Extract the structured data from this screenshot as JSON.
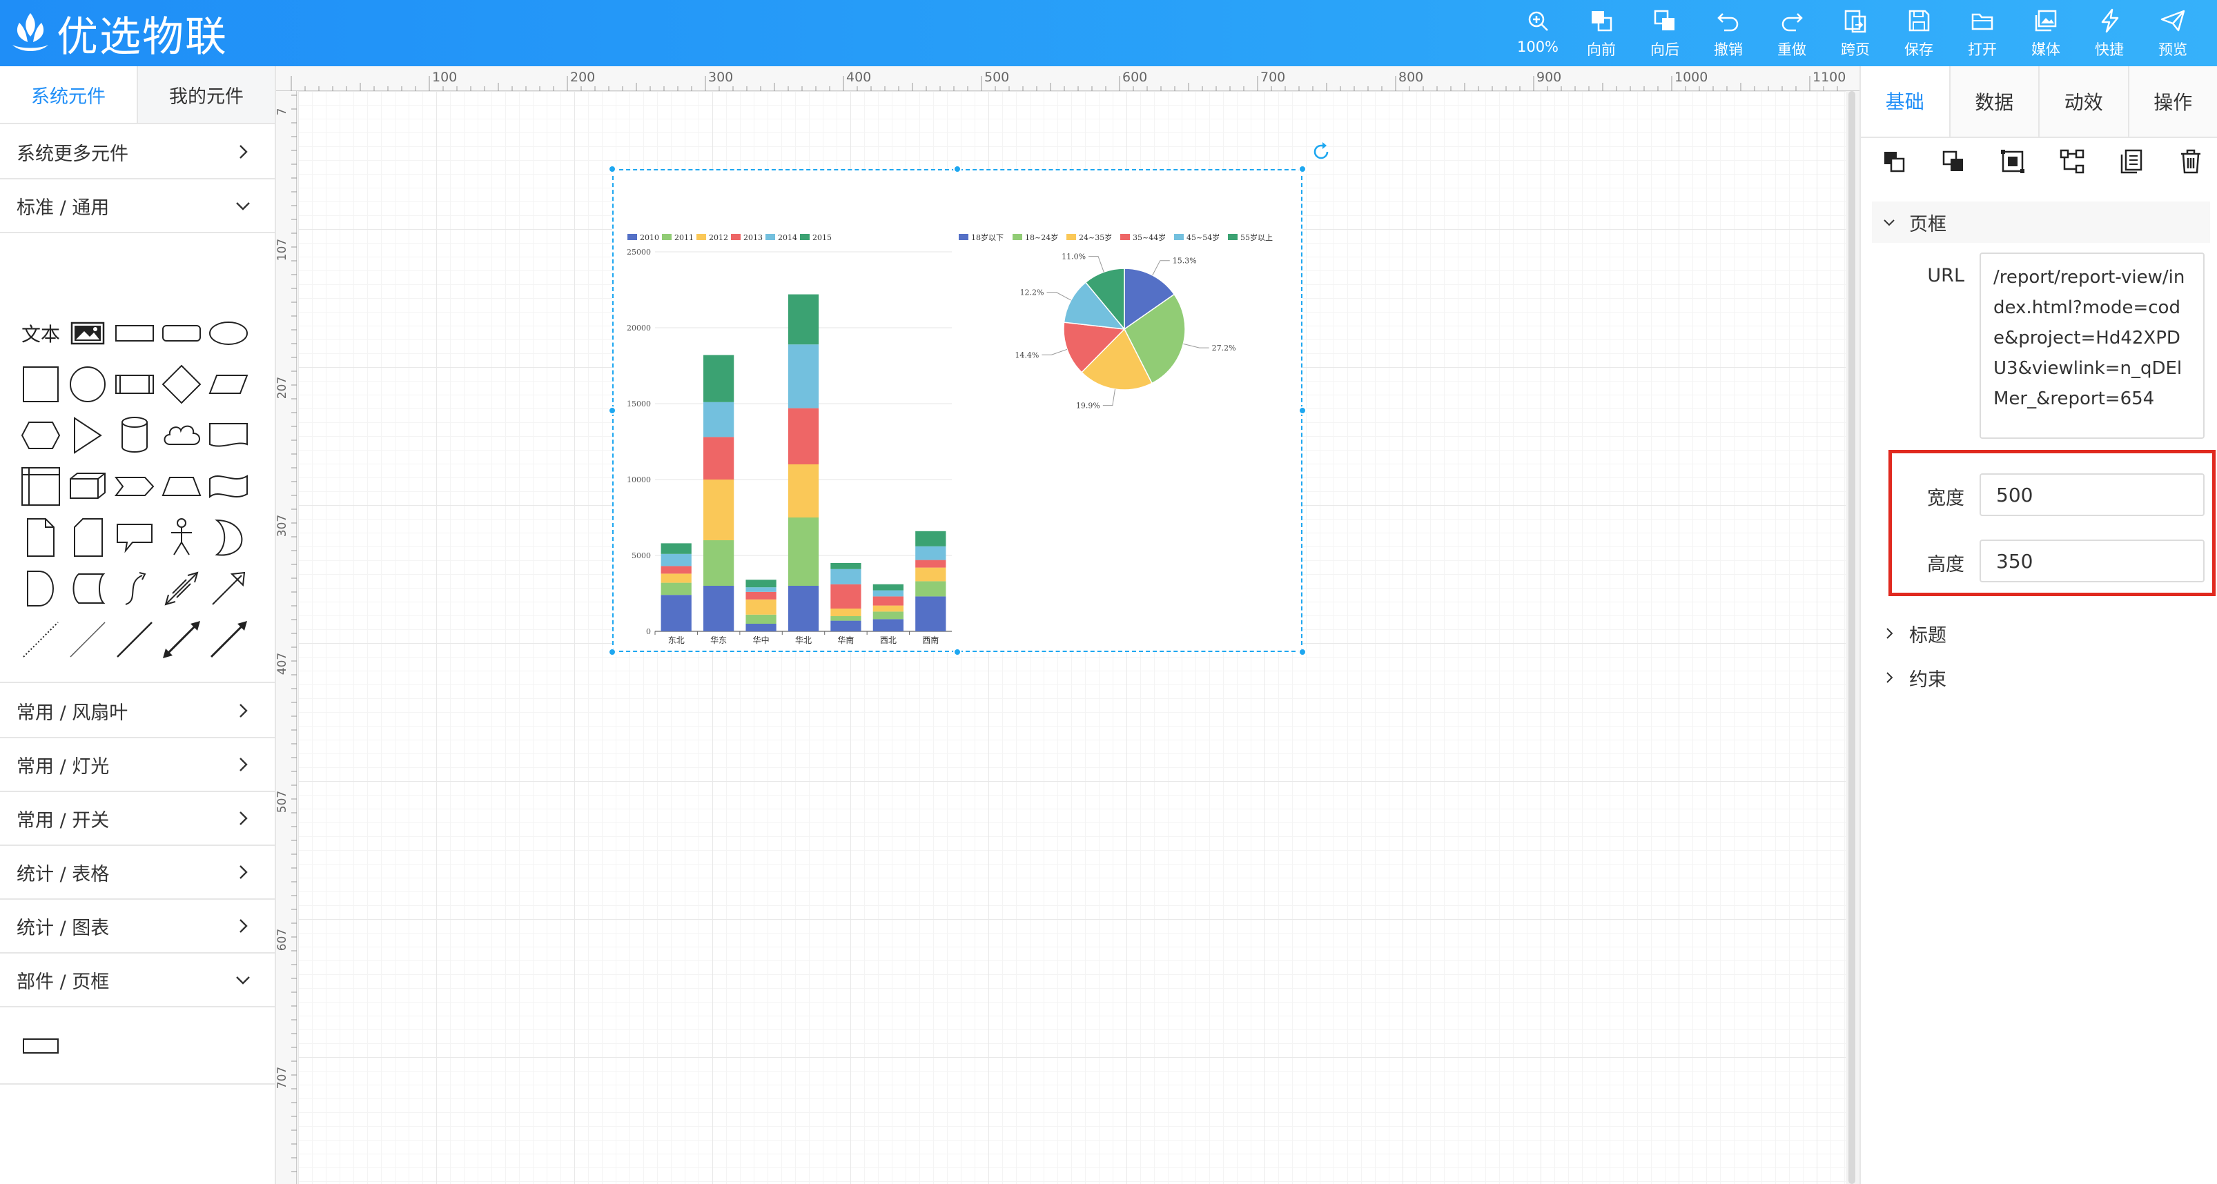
{
  "app": {
    "title": "优选物联"
  },
  "toolbar": {
    "buttons": [
      {
        "label": "100%",
        "icon": "zoom-in-icon"
      },
      {
        "label": "向前",
        "icon": "bring-forward-icon"
      },
      {
        "label": "向后",
        "icon": "send-backward-icon"
      },
      {
        "label": "撤销",
        "icon": "undo-icon"
      },
      {
        "label": "重做",
        "icon": "redo-icon"
      },
      {
        "label": "跨页",
        "icon": "cross-page-icon"
      },
      {
        "label": "保存",
        "icon": "save-icon"
      },
      {
        "label": "打开",
        "icon": "folder-open-icon"
      },
      {
        "label": "媒体",
        "icon": "media-icon"
      },
      {
        "label": "快捷",
        "icon": "lightning-icon"
      },
      {
        "label": "预览",
        "icon": "send-preview-icon"
      }
    ]
  },
  "left_panel": {
    "tabs": [
      "系统元件",
      "我的元件"
    ],
    "sections": {
      "more": "系统更多元件",
      "standard": "标准 / 通用",
      "fan": "常用 / 风扇叶",
      "light": "常用 / 灯光",
      "switch": "常用 / 开关",
      "table": "统计 / 表格",
      "chart": "统计 / 图表",
      "frame": "部件 / 页框"
    },
    "text_shape_label": "文本"
  },
  "ruler": {
    "top_labels": [
      "100",
      "200",
      "300",
      "400",
      "500",
      "600",
      "700",
      "800",
      "900",
      "1000",
      "1100"
    ],
    "left_labels": [
      "7",
      "107",
      "207",
      "307",
      "407",
      "507",
      "607",
      "707"
    ]
  },
  "chart_data": [
    {
      "type": "bar",
      "stacked": true,
      "categories": [
        "东北",
        "华东",
        "华中",
        "华北",
        "华南",
        "西北",
        "西南"
      ],
      "series": [
        {
          "name": "2010",
          "color": "#5470c6",
          "values": [
            2400,
            3000,
            500,
            3000,
            700,
            800,
            2300
          ]
        },
        {
          "name": "2011",
          "color": "#91cc75",
          "values": [
            800,
            3000,
            600,
            4500,
            300,
            500,
            1000
          ]
        },
        {
          "name": "2012",
          "color": "#fac858",
          "values": [
            600,
            4000,
            1000,
            3500,
            500,
            400,
            900
          ]
        },
        {
          "name": "2013",
          "color": "#ee6666",
          "values": [
            500,
            2800,
            500,
            3700,
            1600,
            600,
            500
          ]
        },
        {
          "name": "2014",
          "color": "#73c0de",
          "values": [
            800,
            2300,
            300,
            4200,
            1000,
            400,
            900
          ]
        },
        {
          "name": "2015",
          "color": "#3ba272",
          "values": [
            700,
            3100,
            500,
            3300,
            400,
            400,
            1000
          ]
        }
      ],
      "ylim": [
        0,
        25000
      ],
      "yticks": [
        "0",
        "5000",
        "10000",
        "15000",
        "20000",
        "25000"
      ],
      "legend": "top-left"
    },
    {
      "type": "pie",
      "labels": [
        "18岁以下",
        "18~24岁",
        "24~35岁",
        "35~44岁",
        "45~54岁",
        "55岁以上"
      ],
      "values": [
        15.3,
        27.2,
        19.9,
        14.4,
        12.2,
        11.0
      ],
      "value_labels": [
        "15.3%",
        "27.2%",
        "19.9%",
        "14.4%",
        "12.2%",
        "11.0%"
      ],
      "colors": [
        "#5470c6",
        "#91cc75",
        "#fac858",
        "#ee6666",
        "#73c0de",
        "#3ba272"
      ],
      "legend": "top"
    }
  ],
  "right_panel": {
    "tabs": [
      "基础",
      "数据",
      "动效",
      "操作"
    ],
    "group_frame": "页框",
    "url_label": "URL",
    "url_value": "/report/report-view/index.html?mode=code&project=Hd42XPDU3&viewlink=n_qDElMer_&report=654",
    "width_label": "宽度",
    "width_value": "500",
    "height_label": "高度",
    "height_value": "350",
    "group_title": "标题",
    "group_constraint": "约束"
  }
}
